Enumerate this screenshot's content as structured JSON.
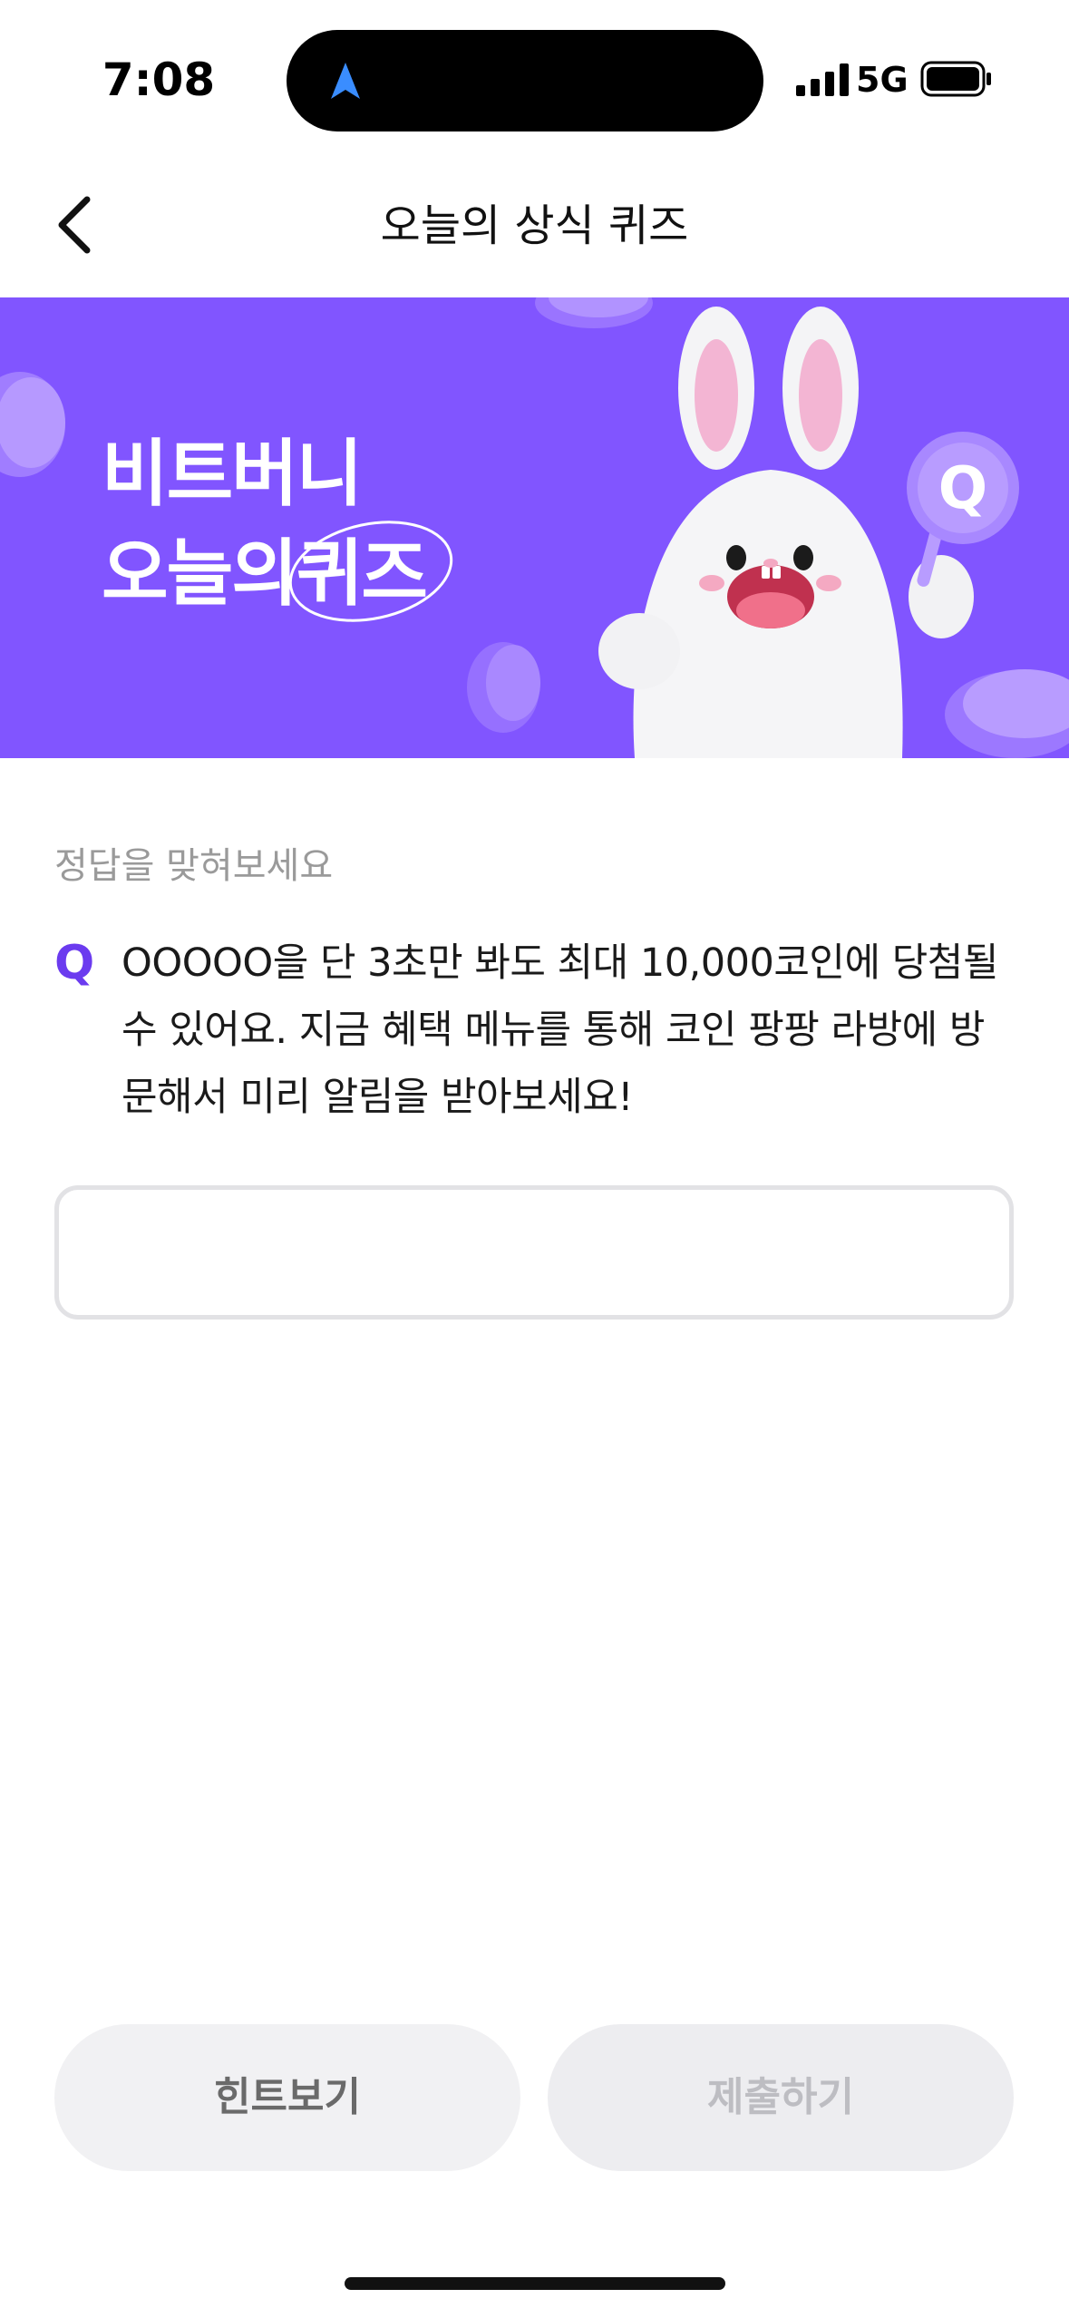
{
  "status_bar": {
    "time": "7:08",
    "network": "5G",
    "icons": [
      "location-arrow-icon",
      "signal-bars-icon",
      "battery-icon"
    ]
  },
  "header": {
    "title": "오늘의 상식 퀴즈",
    "back_icon": "chevron-left-icon"
  },
  "banner": {
    "line1": "비트버니",
    "line2_prefix": "오늘의",
    "line2_highlight": "퀴즈",
    "background_color": "#8155ff",
    "character": "rabbit-mascot",
    "sign_letter": "Q"
  },
  "quiz": {
    "prompt_label": "정답을 맞혀보세요",
    "q_marker": "Q",
    "question": "OOOOO을 단 3초만 봐도 최대 10,000코인에 당첨될 수 있어요. 지금 혜택 메뉴를 통해 코인 팡팡 라방에 방문해서 미리 알림을 받아보세요!",
    "answer_value": "",
    "accent_color": "#6b3bef"
  },
  "actions": {
    "hint_label": "힌트보기",
    "submit_label": "제출하기"
  }
}
